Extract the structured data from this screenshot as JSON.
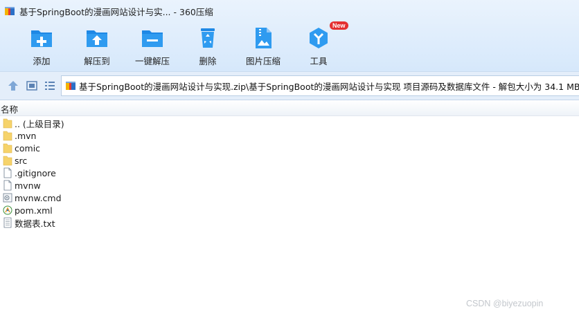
{
  "window": {
    "title": "基于SpringBoot的漫画网站设计与实... - 360压缩"
  },
  "toolbar": {
    "buttons": [
      {
        "label": "添加",
        "icon": "add-icon"
      },
      {
        "label": "解压到",
        "icon": "extract-to-icon"
      },
      {
        "label": "一键解压",
        "icon": "one-click-extract-icon"
      },
      {
        "label": "删除",
        "icon": "delete-icon"
      },
      {
        "label": "图片压缩",
        "icon": "image-compress-icon"
      },
      {
        "label": "工具",
        "icon": "tools-icon",
        "badge": "New"
      }
    ]
  },
  "address_bar": {
    "path": "基于SpringBoot的漫画网站设计与实现.zip\\基于SpringBoot的漫画网站设计与实现 项目源码及数据库文件 - 解包大小为 34.1 MB"
  },
  "file_list": {
    "column_name": "名称",
    "items": [
      {
        "name": ".. (上级目录)",
        "type": "folder"
      },
      {
        "name": ".mvn",
        "type": "folder"
      },
      {
        "name": "comic",
        "type": "folder"
      },
      {
        "name": "src",
        "type": "folder"
      },
      {
        "name": ".gitignore",
        "type": "file"
      },
      {
        "name": "mvnw",
        "type": "file"
      },
      {
        "name": "mvnw.cmd",
        "type": "cmd"
      },
      {
        "name": "pom.xml",
        "type": "xml"
      },
      {
        "name": "数据表.txt",
        "type": "txt"
      }
    ]
  },
  "watermark": "CSDN @biyezuopin",
  "colors": {
    "accent_blue": "#1e88e5",
    "toolbar_bg": "#dbeafb",
    "folder_yellow": "#f6d36b",
    "badge_red": "#e43030"
  }
}
